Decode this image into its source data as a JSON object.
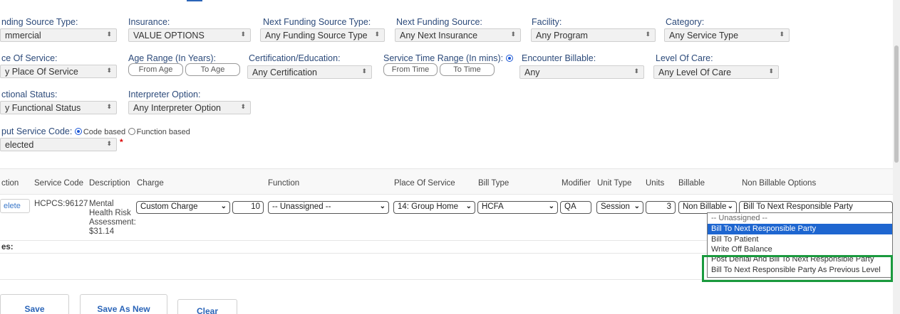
{
  "filters": {
    "funding_source_type": {
      "label": "nding Source Type:",
      "value": "mmercial"
    },
    "insurance": {
      "label": "Insurance:",
      "value": "VALUE OPTIONS"
    },
    "next_funding_source_type": {
      "label": "Next Funding Source Type:",
      "value": "Any Funding Source Type"
    },
    "next_funding_source": {
      "label": "Next Funding Source:",
      "value": "Any Next Insurance"
    },
    "facility": {
      "label": "Facility:",
      "value": "Any Program"
    },
    "category": {
      "label": "Category:",
      "value": "Any Service Type"
    },
    "place_of_service": {
      "label": "ce Of Service:",
      "value": "y Place Of Service"
    },
    "age_range": {
      "label": "Age Range (In Years):",
      "from_placeholder": "From Age",
      "to_placeholder": "To Age"
    },
    "certification": {
      "label": "Certification/Education:",
      "value": "Any Certification"
    },
    "service_time_range": {
      "label": "Service Time Range (In mins):",
      "from_placeholder": "From Time",
      "to_placeholder": "To Time"
    },
    "encounter_billable": {
      "label": "Encounter Billable:",
      "value": "Any"
    },
    "level_of_care": {
      "label": "Level Of Care:",
      "value": "Any Level Of Care"
    },
    "functional_status": {
      "label": "ctional Status:",
      "value": "y Functional Status"
    },
    "interpreter_option": {
      "label": "Interpreter Option:",
      "value": "Any Interpreter Option"
    },
    "input_service_code": {
      "label": "put Service Code:",
      "option_code": "Code based",
      "option_function": "Function based",
      "value": "elected",
      "required_mark": "*"
    }
  },
  "table": {
    "headers": {
      "action": "ction",
      "service_code": "Service Code",
      "description": "Description",
      "charge": "Charge",
      "function": "Function",
      "place_of_service": "Place Of Service",
      "bill_type": "Bill Type",
      "modifier": "Modifier",
      "unit_type": "Unit Type",
      "units": "Units",
      "billable": "Billable",
      "non_billable_options": "Non Billable Options"
    },
    "row": {
      "action": "elete",
      "service_code": "HCPCS:96127",
      "description": "Mental Health Risk Assessment: $31.14",
      "charge": "Custom Charge",
      "charge_amount": "10",
      "function": "-- Unassigned --",
      "place_of_service": "14: Group Home",
      "bill_type": "HCFA",
      "modifier": "QA",
      "unit_type": "Session",
      "units": "3",
      "billable": "Non Billable",
      "non_billable_option": "Bill To Next Responsible Party"
    },
    "notes_label": "es:"
  },
  "dropdown": {
    "options": [
      "-- Unassigned --",
      "Bill To Next Responsible Party",
      "Bill To Patient",
      "Write Off Balance",
      "Post Denial And Bill To Next Responsible Party",
      "Bill To Next Responsible Party As Previous Level"
    ],
    "selected_index": 1,
    "highlight_color": "#1a9a3e"
  },
  "buttons": {
    "save": "Save",
    "save_as_new": "Save As New",
    "clear": "Clear"
  }
}
